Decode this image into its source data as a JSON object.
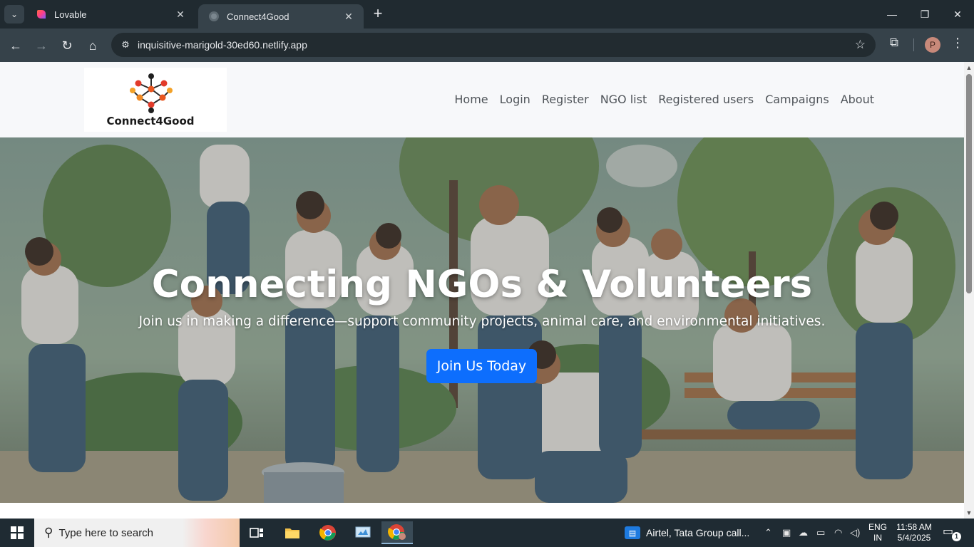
{
  "browser": {
    "tabs": [
      {
        "title": "Lovable",
        "active": false
      },
      {
        "title": "Connect4Good",
        "active": true
      }
    ],
    "address": "inquisitive-marigold-30ed60.netlify.app",
    "profile_initial": "P"
  },
  "site": {
    "logo_text": "Connect4Good",
    "nav": [
      "Home",
      "Login",
      "Register",
      "NGO list",
      "Registered users",
      "Campaigns",
      "About"
    ],
    "hero": {
      "title": "Connecting NGOs & Volunteers",
      "subtitle": "Join us in making a difference—support community projects, animal care, and environmental initiatives.",
      "cta": "Join Us Today"
    },
    "colors": {
      "cta": "#0d6efd",
      "header_bg": "#f7f8fa"
    }
  },
  "taskbar": {
    "search_placeholder": "Type here to search",
    "news": "Airtel, Tata Group call...",
    "lang_line1": "ENG",
    "lang_line2": "IN",
    "time": "11:58 AM",
    "date": "5/4/2025",
    "notification_count": "1"
  }
}
